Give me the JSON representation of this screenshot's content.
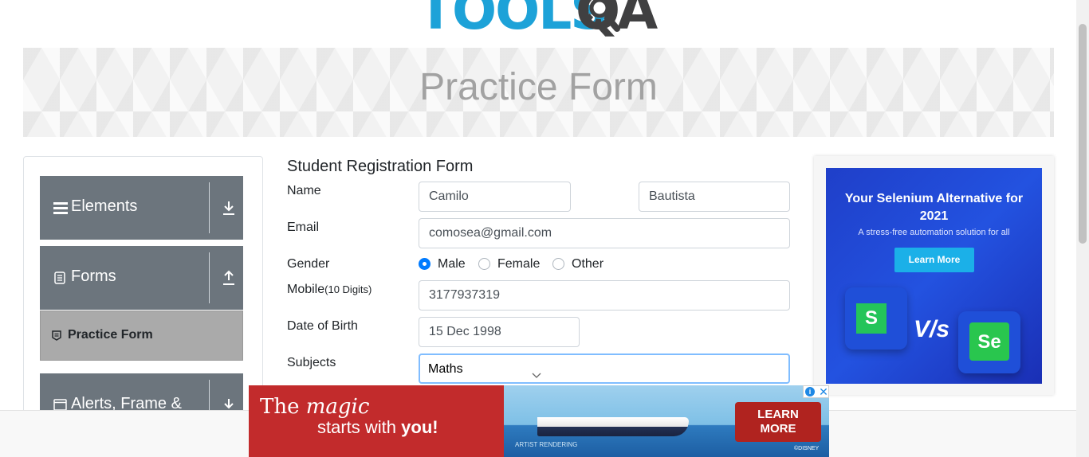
{
  "logo": {
    "text_left": "TOOLS",
    "text_right": "QA"
  },
  "banner": {
    "title": "Practice Form"
  },
  "sidebar": {
    "groups": [
      {
        "label": "Elements",
        "icon": "hamburger-icon",
        "arrow": "download-arrow-icon"
      },
      {
        "label": "Forms",
        "icon": "document-icon",
        "arrow": "upload-arrow-icon"
      },
      {
        "label": "Alerts, Frame &",
        "icon": "window-icon",
        "arrow": "download-arrow-icon"
      }
    ],
    "active_item": {
      "label": "Practice Form",
      "icon": "form-icon"
    }
  },
  "form": {
    "title": "Student Registration Form",
    "name_label": "Name",
    "first_name": "Camilo",
    "last_name": "Bautista",
    "email_label": "Email",
    "email": "comosea@gmail.com",
    "gender_label": "Gender",
    "gender_options": [
      "Male",
      "Female",
      "Other"
    ],
    "gender_selected": "Male",
    "mobile_label": "Mobile",
    "mobile_hint": "(10 Digits)",
    "mobile": "3177937319",
    "dob_label": "Date of Birth",
    "dob": "15 Dec 1998",
    "subjects_label": "Subjects",
    "subjects_value": "Maths"
  },
  "ad_right": {
    "headline": "Your Selenium Alternative for 2021",
    "subtitle": "A stress-free automation solution for all",
    "button": "Learn More",
    "tile_left": "S",
    "vs": "V/s",
    "tile_right": "Se"
  },
  "ad_bottom": {
    "line1_a": "The ",
    "line1_b": "magic",
    "line2_a": "starts with ",
    "line2_b": "you!",
    "button_line1": "LEARN",
    "button_line2": "MORE",
    "caption": "ARTIST RENDERING",
    "copyright": "©DISNEY",
    "adchoice_info": "i",
    "adchoice_close": "✕"
  },
  "colors": {
    "accent": "#007bff",
    "sidebar_group": "#6c757d",
    "sidebar_active": "#aaaaaa",
    "logo_blue": "#1da2d8"
  }
}
